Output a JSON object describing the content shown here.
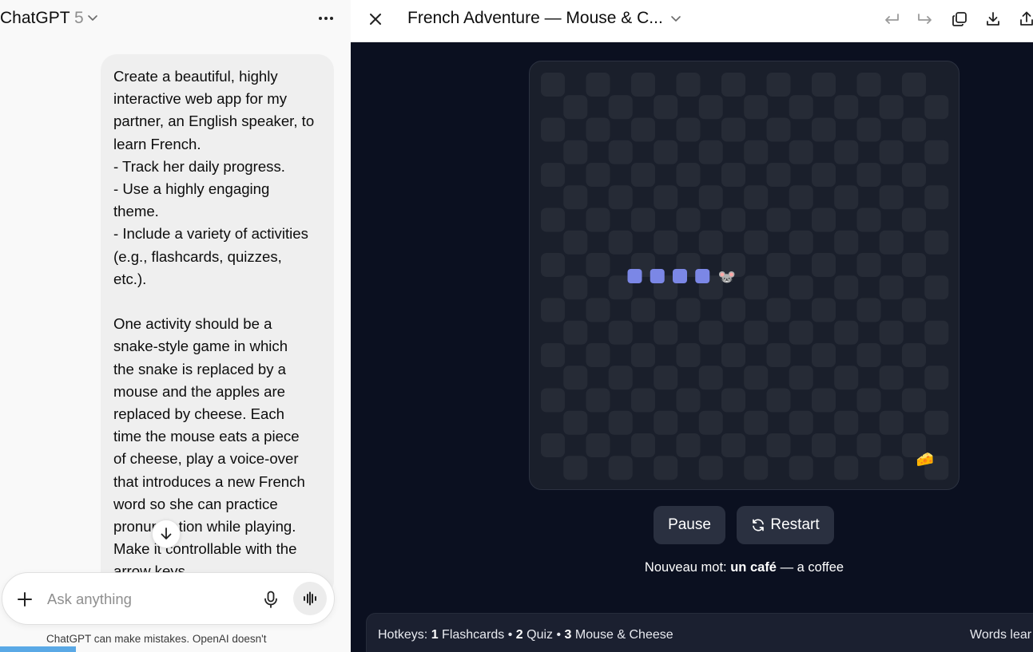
{
  "chat": {
    "model_name": "ChatGPT",
    "model_version": "5",
    "message": "Create a beautiful, highly\ninteractive web app for my\npartner, an English speaker, to\nlearn French.\n- Track her daily progress.\n- Use a highly engaging\ntheme.\n- Include a variety of activities\n(e.g., flashcards, quizzes,\netc.).\n\nOne activity should be a\nsnake-style game in which\nthe snake is replaced by a\nmouse and the apples are\nreplaced by cheese. Each\ntime the mouse eats a piece\nof cheese, play a voice-over\nthat introduces a new French\nword so she can practice\npronunciation while playing.\nMake it controllable with the\narrow keys.",
    "composer_placeholder": "Ask anything",
    "disclaimer": "ChatGPT can make mistakes. OpenAI doesn't"
  },
  "preview": {
    "title": "French Adventure — Mouse & C...",
    "colors": {
      "background": "#0b1020",
      "board": "#1a1f2b",
      "cell_dark": "#262b36",
      "snake_body": "#7b87e6",
      "button": "#2a3040"
    },
    "game": {
      "cols": 9,
      "rows": 9,
      "snake_body": [
        [
          1,
          4
        ],
        [
          1.5,
          4
        ],
        [
          2,
          4
        ],
        [
          2.5,
          4
        ]
      ],
      "mouse": {
        "col": 3,
        "row": 4,
        "glyph": "🐭"
      },
      "cheese": {
        "col": 7.5,
        "row": 8.5,
        "glyph": "🧀"
      }
    },
    "controls": {
      "pause": "Pause",
      "restart": "Restart"
    },
    "word": {
      "prefix": "Nouveau mot: ",
      "french": "un café",
      "translation": " — a coffee"
    },
    "footer": {
      "hotkeys_label": "Hotkeys: ",
      "hotkeys": [
        {
          "key": "1",
          "label": " Flashcards"
        },
        {
          "key": "2",
          "label": " Quiz"
        },
        {
          "key": "3",
          "label": " Mouse & Cheese"
        }
      ],
      "separator": " • ",
      "words_learned": "Words lear"
    }
  }
}
